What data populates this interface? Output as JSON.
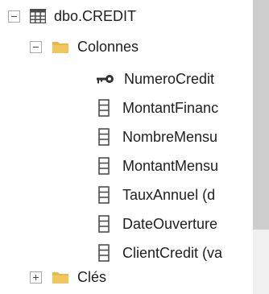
{
  "tree": {
    "table_label": "dbo.CREDIT",
    "columns_folder_label": "Colonnes",
    "columns": [
      "NumeroCredit",
      "MontantFinanc",
      "NombreMensu",
      "MontantMensu",
      "TauxAnnuel (d",
      "DateOuverture",
      "ClientCredit (va"
    ],
    "keys_folder_label": "Clés"
  },
  "colors": {
    "folder": "#e8b84c",
    "table_icon": "#4d4d4d",
    "text": "#1e1e1e",
    "scrollbar_track": "#f0f0f0",
    "scrollbar_thumb": "#cdcdcd"
  }
}
